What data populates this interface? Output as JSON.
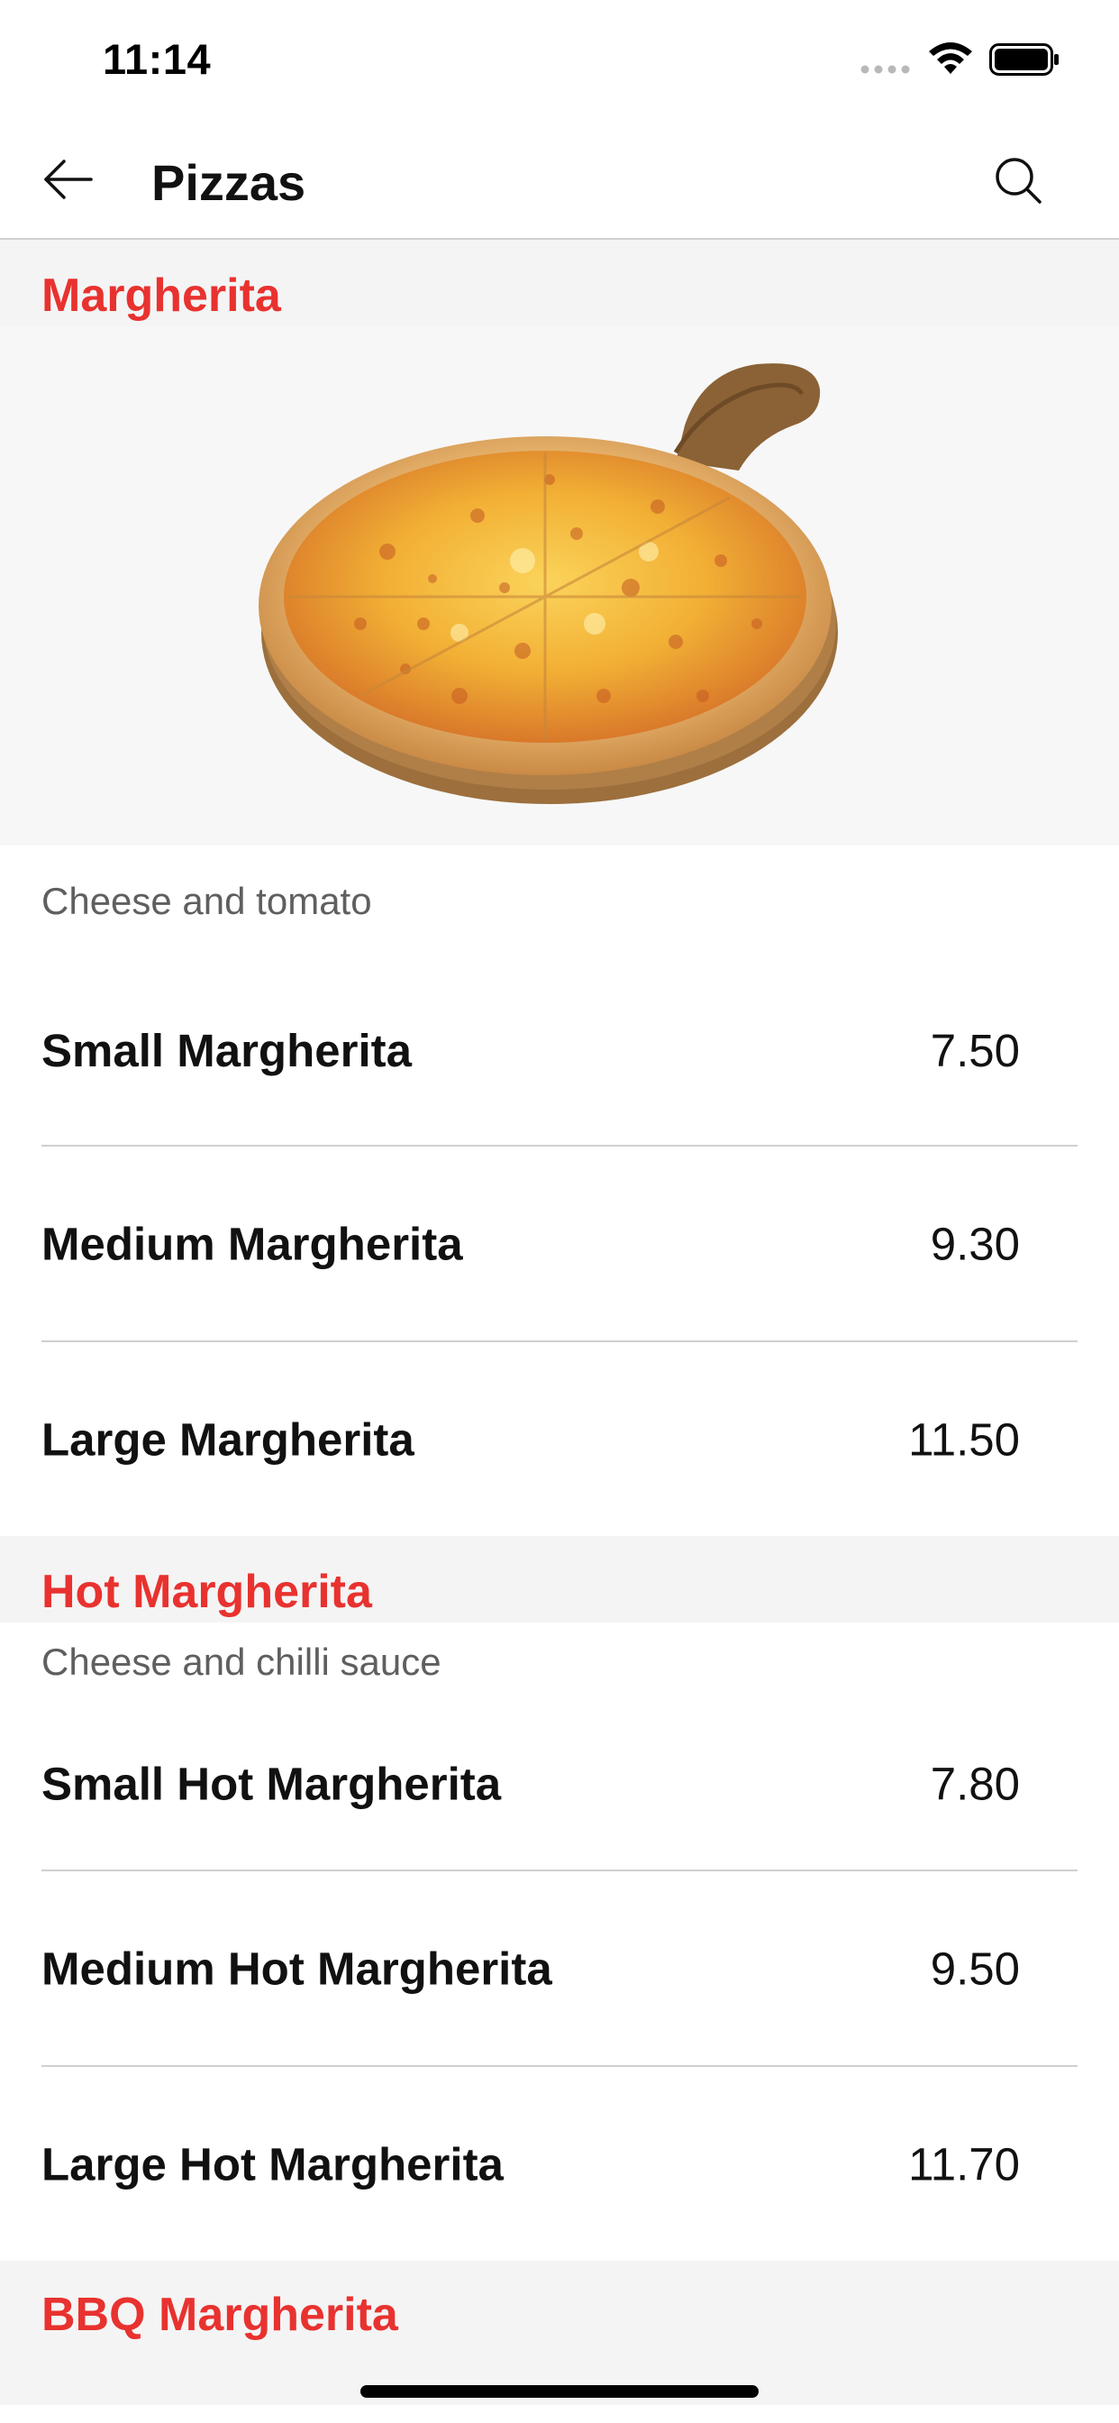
{
  "status_bar": {
    "time": "11:14"
  },
  "nav": {
    "title": "Pizzas",
    "back_icon": "arrow-left-icon",
    "search_icon": "search-icon"
  },
  "colors": {
    "accent": "#e8322f",
    "section_background": "#f4f4f4",
    "divider": "#cfcfcf",
    "description_text": "#5f5f5f"
  },
  "sections": [
    {
      "title": "Margherita",
      "description": "Cheese and tomato",
      "items": [
        {
          "name": "Small Margherita",
          "price": "7.50"
        },
        {
          "name": "Medium Margherita",
          "price": "9.30"
        },
        {
          "name": "Large Margherita",
          "price": "11.50"
        }
      ]
    },
    {
      "title": "Hot Margherita",
      "description": "Cheese and chilli sauce",
      "items": [
        {
          "name": "Small Hot Margherita",
          "price": "7.80"
        },
        {
          "name": "Medium Hot Margherita",
          "price": "9.50"
        },
        {
          "name": "Large Hot Margherita",
          "price": "11.70"
        }
      ]
    },
    {
      "title": "BBQ Margherita"
    }
  ]
}
